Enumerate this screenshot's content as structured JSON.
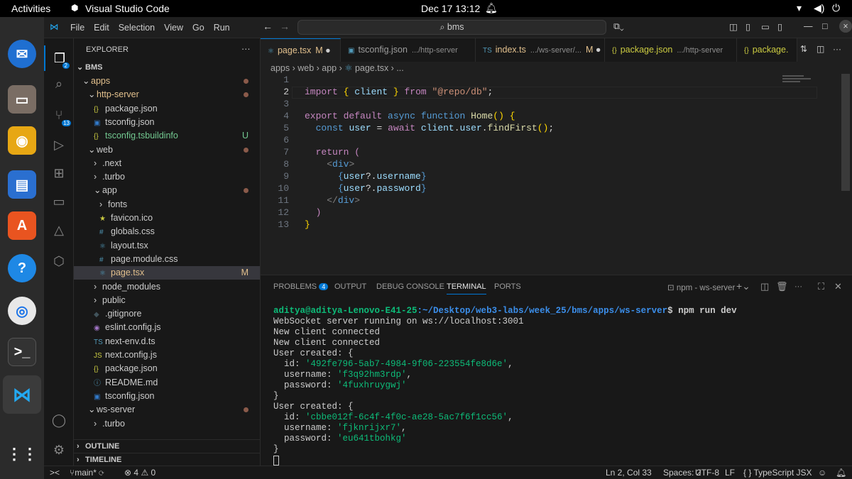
{
  "topbar": {
    "activities": "Activities",
    "datetime": "Dec 17  13:12"
  },
  "titlebar": {
    "menu": [
      "File",
      "Edit",
      "Selection",
      "View",
      "Go",
      "Run"
    ],
    "search": "bms"
  },
  "activity": {
    "explorer_badge": "2",
    "scm_badge": "13"
  },
  "sidebar": {
    "title": "EXPLORER",
    "root": "BMS",
    "items": [
      {
        "label": "apps",
        "depth": 1,
        "type": "folder-open",
        "color": "#e2c08d",
        "dot": true
      },
      {
        "label": "http-server",
        "depth": 2,
        "type": "folder-open",
        "color": "#e2c08d",
        "dot": true
      },
      {
        "label": "package.json",
        "depth": 3,
        "icon": "{}",
        "iconColor": "#cbcb41"
      },
      {
        "label": "tsconfig.json",
        "depth": 3,
        "icon": "▣",
        "iconColor": "#3178c6"
      },
      {
        "label": "tsconfig.tsbuildinfo",
        "depth": 3,
        "icon": "{}",
        "iconColor": "#cbcb41",
        "color": "#73c991",
        "badge": "U"
      },
      {
        "label": "web",
        "depth": 2,
        "type": "folder-open",
        "dot": true
      },
      {
        "label": ".next",
        "depth": 3,
        "type": "folder"
      },
      {
        "label": ".turbo",
        "depth": 3,
        "type": "folder"
      },
      {
        "label": "app",
        "depth": 3,
        "type": "folder-open",
        "dot": true
      },
      {
        "label": "fonts",
        "depth": 4,
        "type": "folder"
      },
      {
        "label": "favicon.ico",
        "depth": 4,
        "icon": "★",
        "iconColor": "#cbcb41"
      },
      {
        "label": "globals.css",
        "depth": 4,
        "icon": "#",
        "iconColor": "#519aba"
      },
      {
        "label": "layout.tsx",
        "depth": 4,
        "icon": "⚛",
        "iconColor": "#519aba"
      },
      {
        "label": "page.module.css",
        "depth": 4,
        "icon": "#",
        "iconColor": "#519aba"
      },
      {
        "label": "page.tsx",
        "depth": 4,
        "icon": "⚛",
        "iconColor": "#519aba",
        "color": "#e2c08d",
        "badge": "M",
        "selected": true
      },
      {
        "label": "node_modules",
        "depth": 3,
        "type": "folder"
      },
      {
        "label": "public",
        "depth": 3,
        "type": "folder"
      },
      {
        "label": ".gitignore",
        "depth": 3,
        "icon": "◆",
        "iconColor": "#41535b"
      },
      {
        "label": "eslint.config.js",
        "depth": 3,
        "icon": "◉",
        "iconColor": "#a074c4"
      },
      {
        "label": "next-env.d.ts",
        "depth": 3,
        "icon": "TS",
        "iconColor": "#519aba"
      },
      {
        "label": "next.config.js",
        "depth": 3,
        "icon": "JS",
        "iconColor": "#cbcb41"
      },
      {
        "label": "package.json",
        "depth": 3,
        "icon": "{}",
        "iconColor": "#cbcb41"
      },
      {
        "label": "README.md",
        "depth": 3,
        "icon": "ⓘ",
        "iconColor": "#519aba"
      },
      {
        "label": "tsconfig.json",
        "depth": 3,
        "icon": "▣",
        "iconColor": "#3178c6"
      },
      {
        "label": "ws-server",
        "depth": 2,
        "type": "folder-open",
        "dot": true
      },
      {
        "label": ".turbo",
        "depth": 3,
        "type": "folder"
      }
    ],
    "outline": "OUTLINE",
    "timeline": "TIMELINE"
  },
  "tabs": [
    {
      "label": "page.tsx",
      "desc": "",
      "mod": "M",
      "icon": "⚛",
      "active": true
    },
    {
      "label": "tsconfig.json",
      "desc": ".../http-server",
      "icon": "▣"
    },
    {
      "label": "index.ts",
      "desc": ".../ws-server/...",
      "mod": "M",
      "icon": "TS"
    },
    {
      "label": "package.json",
      "desc": ".../http-server",
      "icon": "{}"
    },
    {
      "label": "package.",
      "desc": "",
      "icon": "{}"
    }
  ],
  "breadcrumb": [
    "apps",
    "web",
    "app",
    "page.tsx",
    "..."
  ],
  "code": {
    "lines": [
      "1",
      "2",
      "3",
      "4",
      "5",
      "6",
      "7",
      "8",
      "9",
      "10",
      "11",
      "12",
      "13"
    ]
  },
  "panel": {
    "tabs": [
      "PROBLEMS",
      "OUTPUT",
      "DEBUG CONSOLE",
      "TERMINAL",
      "PORTS"
    ],
    "problems_count": "4",
    "terminal_name": "npm - ws-server"
  },
  "terminal": {
    "prompt": "aditya@aditya-Lenovo-E41-25",
    "path": ":~/Desktop/web3-labs/week_25/bms/apps/ws-server",
    "cmd": "$ npm run dev",
    "l1": "WebSocket server running on ws://localhost:3001",
    "l2": "New client connected",
    "l3": "New client connected",
    "u1": {
      "head": "User created: {",
      "id": "'492fe796-5ab7-4984-9f06-223554fe8d6e'",
      "username": "'f3q92hm3rdp'",
      "password": "'4fuxhruygwj'"
    },
    "u2": {
      "head": "User created: {",
      "id": "'cbbe012f-6c4f-4f0c-ae28-5ac7f6f1cc56'",
      "username": "'fjknrijxr7'",
      "password": "'eu641tbohkg'"
    },
    "k_id": "  id: ",
    "k_user": "  username: ",
    "k_pass": "  password: ",
    "close": "}"
  },
  "status": {
    "branch": "main*",
    "errors": "4",
    "warnings": "0",
    "position": "Ln 2, Col 33",
    "spaces": "Spaces: 2",
    "encoding": "UTF-8",
    "eol": "LF",
    "language": "TypeScript JSX"
  }
}
